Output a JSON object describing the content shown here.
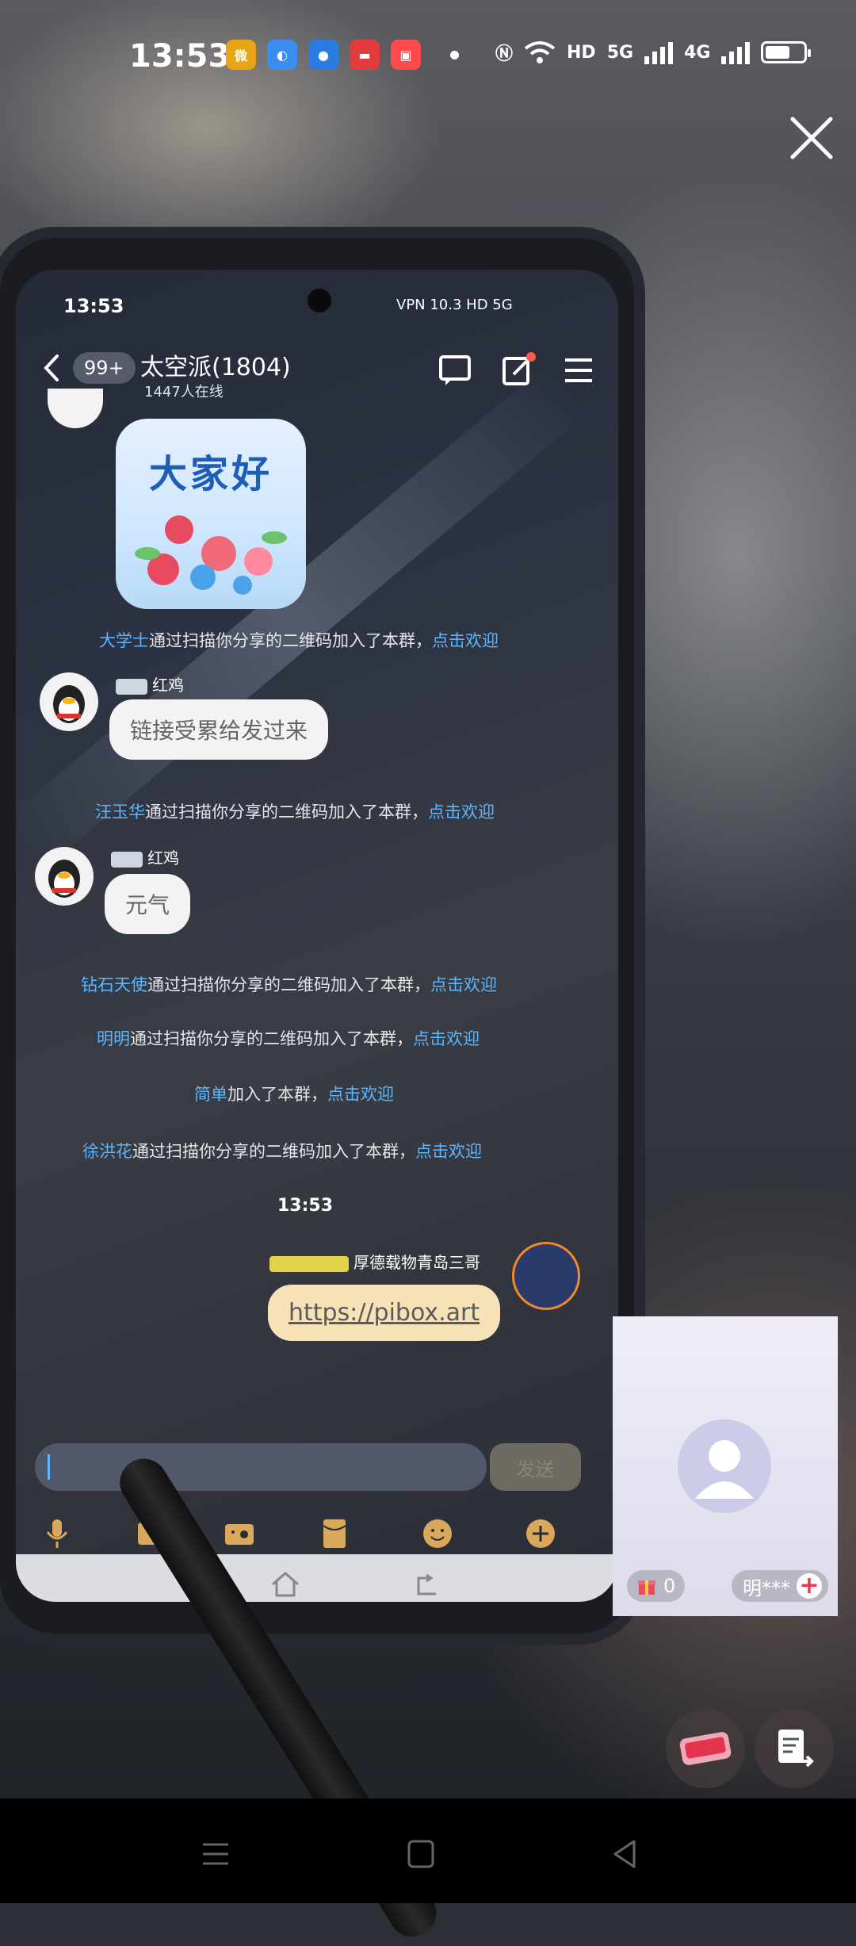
{
  "status_bar": {
    "time": "13:53",
    "apps": [
      {
        "icon": "weibo-icon",
        "color": "#e8a317"
      },
      {
        "icon": "browser-icon",
        "color": "#3a8ef0"
      },
      {
        "icon": "qq-browser-icon",
        "color": "#2a7de0"
      },
      {
        "icon": "app-icon",
        "color": "#e23b3b"
      },
      {
        "icon": "kuaishou-icon",
        "color": "#ff4b4b"
      }
    ],
    "network_labels": [
      "HD",
      "5G",
      "4G"
    ]
  },
  "phone": {
    "status_time": "13:53",
    "status_right": "VPN  10.3  HD  5G",
    "header": {
      "back_badge": "99+",
      "group_title": "太空派(1804)",
      "online": "1447人在线"
    },
    "sticker_text": "大家好",
    "messages": [
      {
        "type": "system",
        "name": "大学士",
        "text": "通过扫描你分享的二维码加入了本群，",
        "link": "点击欢迎"
      },
      {
        "type": "chat",
        "user": "红鸡",
        "text": "链接受累给发过来"
      },
      {
        "type": "system",
        "name": "汪玉华",
        "text": "通过扫描你分享的二维码加入了本群，",
        "link": "点击欢迎"
      },
      {
        "type": "chat",
        "user": "红鸡",
        "text": "元气"
      },
      {
        "type": "system",
        "name": "钻石天使",
        "text": "通过扫描你分享的二维码加入了本群，",
        "link": "点击欢迎"
      },
      {
        "type": "system",
        "name": "明明",
        "text": "通过扫描你分享的二维码加入了本群，",
        "link": "点击欢迎"
      },
      {
        "type": "system",
        "name": "简单",
        "text": "加入了本群，",
        "link": "点击欢迎"
      },
      {
        "type": "system",
        "name": "徐洪花",
        "text": "通过扫描你分享的二维码加入了本群，",
        "link": "点击欢迎"
      },
      {
        "type": "time",
        "text": "13:53"
      },
      {
        "type": "self",
        "user": "厚德载物青岛三哥",
        "text": "https://pibox.art"
      }
    ],
    "send_label": "发送"
  },
  "video_inset": {
    "gift_count": "0",
    "viewer_name": "明***"
  }
}
